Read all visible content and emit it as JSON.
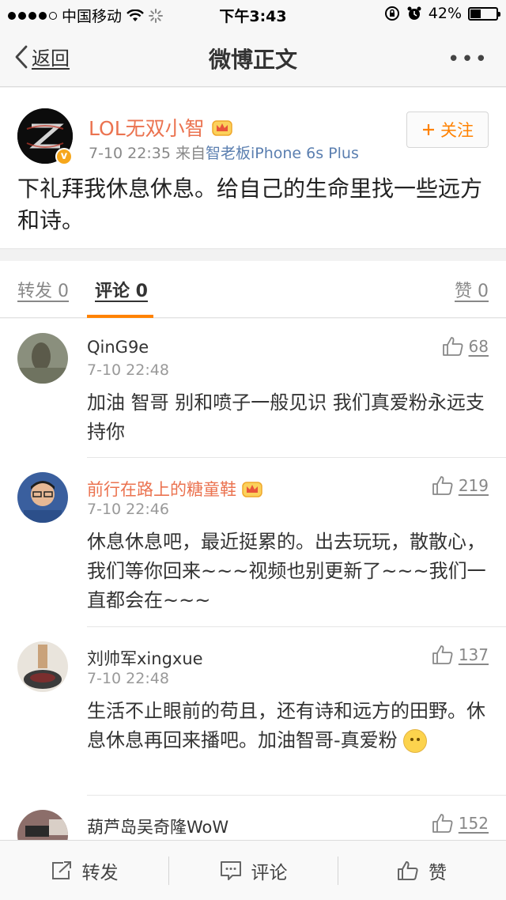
{
  "status_bar": {
    "carrier": "中国移动",
    "time": "下午3:43",
    "battery": "42%",
    "battery_level": 0.42
  },
  "nav": {
    "back_label": "返回",
    "title": "微博正文",
    "more": "•••"
  },
  "post": {
    "author": "LOL无双小智",
    "time": "7-10 22:35",
    "source_prefix": "来自",
    "source": "智老板iPhone 6s Plus",
    "follow_label": "关注",
    "text": "下礼拜我休息休息。给自己的生命里找一些远方和诗。"
  },
  "tabs": {
    "repost": "转发 0",
    "comment": "评论 0",
    "like": "赞 0"
  },
  "comments": [
    {
      "name": "QinG9e",
      "time": "7-10 22:48",
      "likes": "68",
      "vip": false,
      "text": "加油 智哥 别和喷子一般见识 我们真爱粉永远支持你"
    },
    {
      "name": "前行在路上的糖童鞋",
      "time": "7-10 22:46",
      "likes": "219",
      "vip": true,
      "text": "休息休息吧，最近挺累的。出去玩玩，散散心，我们等你回来~~~视频也别更新了~~~我们一直都会在~~~"
    },
    {
      "name": "刘帅军xingxue",
      "time": "7-10 22:48",
      "likes": "137",
      "vip": false,
      "text": "生活不止眼前的苟且，还有诗和远方的田野。休息休息再回来播吧。加油智哥-真爱粉"
    },
    {
      "name": "葫芦岛吴奇隆WoW",
      "time": "",
      "likes": "152",
      "vip": false,
      "text": ""
    }
  ],
  "bottom_bar": {
    "repost": "转发",
    "comment": "评论",
    "like": "赞"
  },
  "colors": {
    "orange_name": "#eb7350",
    "accent": "#ff8200",
    "link_blue": "#5b7fb0"
  }
}
